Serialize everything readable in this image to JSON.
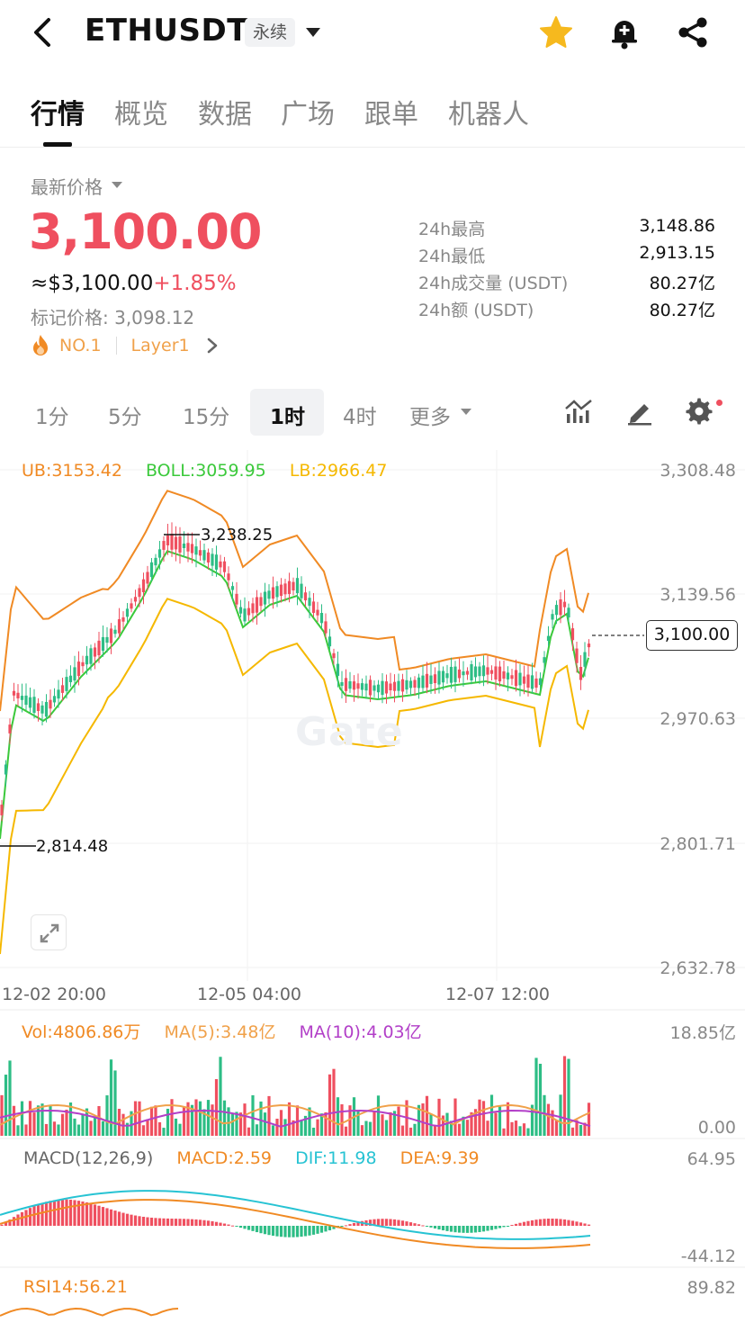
{
  "header": {
    "pair": "ETHUSDT",
    "contract_type": "永续"
  },
  "tabs": [
    "行情",
    "概览",
    "数据",
    "广场",
    "跟单",
    "机器人"
  ],
  "price": {
    "label": "最新价格",
    "last": "3,100.00",
    "usd": "≈$3,100.00",
    "change_pct": "+1.85%",
    "mark_price": "标记价格: 3,098.12",
    "rank": "NO.1",
    "sector": "Layer1"
  },
  "stats": [
    {
      "label": "24h最高",
      "value": "3,148.86"
    },
    {
      "label": "24h最低",
      "value": "2,913.15"
    },
    {
      "label": "24h成交量 (USDT)",
      "value": "80.27亿"
    },
    {
      "label": "24h额 (USDT)",
      "value": "80.27亿"
    }
  ],
  "intervals": {
    "items": [
      "1分",
      "5分",
      "15分",
      "1时",
      "4时",
      "更多"
    ],
    "active": "1时"
  },
  "chart": {
    "boll_legend": {
      "ub": "UB:3153.42",
      "boll": "BOLL:3059.95",
      "lb": "LB:2966.47"
    },
    "y_ticks": [
      "3,308.48",
      "3,139.56",
      "2,970.63",
      "2,801.71",
      "2,632.78"
    ],
    "x_ticks": [
      "12-02 20:00",
      "12-05 04:00",
      "12-07 12:00"
    ],
    "current_price": "3,100.00",
    "high_marker": "3,238.25",
    "low_marker": "2,814.48",
    "watermark": "Gate",
    "volume": {
      "vol": "Vol:4806.86万",
      "ma5": "MA(5):3.48亿",
      "ma10": "MA(10):4.03亿",
      "max": "18.85亿",
      "min": "0.00"
    },
    "macd": {
      "params": "MACD(12,26,9)",
      "macd": "MACD:2.59",
      "dif": "DIF:11.98",
      "dea": "DEA:9.39",
      "max": "64.95",
      "min": "-44.12"
    },
    "rsi": {
      "rsi": "RSI14:56.21",
      "max": "89.82"
    }
  },
  "colors": {
    "up": "#ef4f5f",
    "down": "#2dbd85",
    "ub": "#f08a24",
    "boll": "#3bc93b",
    "lb": "#f5b800",
    "dif": "#27c3d3",
    "ma10": "#b23fc8"
  }
}
